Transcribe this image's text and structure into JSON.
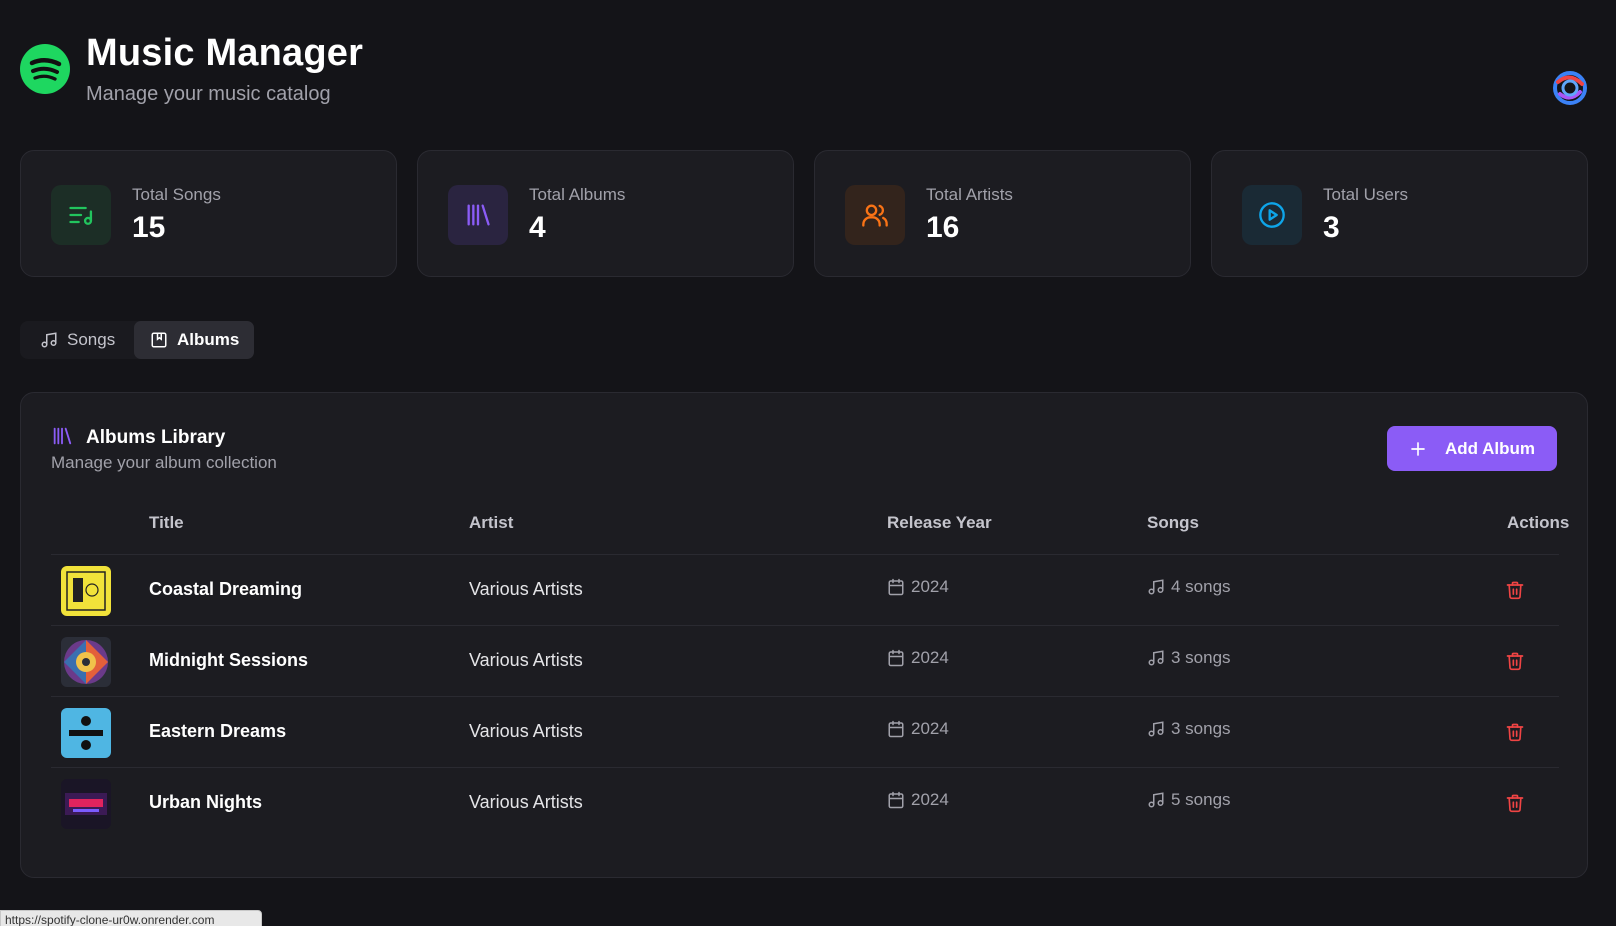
{
  "header": {
    "title": "Music Manager",
    "subtitle": "Manage your music catalog"
  },
  "stats": [
    {
      "label": "Total Songs",
      "value": "15",
      "icon": "music-list-icon",
      "color": "#22c55e"
    },
    {
      "label": "Total Albums",
      "value": "4",
      "icon": "library-icon",
      "color": "#8b5cf6"
    },
    {
      "label": "Total Artists",
      "value": "16",
      "icon": "users-icon",
      "color": "#f97316"
    },
    {
      "label": "Total Users",
      "value": "3",
      "icon": "play-circle-icon",
      "color": "#0ea5e9"
    }
  ],
  "tabs": [
    {
      "label": "Songs",
      "icon": "music-note-icon",
      "active": false
    },
    {
      "label": "Albums",
      "icon": "album-icon",
      "active": true
    }
  ],
  "panel": {
    "title": "Albums Library",
    "subtitle": "Manage your album collection",
    "add_label": "Add Album"
  },
  "table": {
    "columns": [
      "Title",
      "Artist",
      "Release Year",
      "Songs",
      "Actions"
    ],
    "rows": [
      {
        "title": "Coastal Dreaming",
        "artist": "Various Artists",
        "year": "2024",
        "songs": "4 songs",
        "cover": "cover-yellow"
      },
      {
        "title": "Midnight Sessions",
        "artist": "Various Artists",
        "year": "2024",
        "songs": "3 songs",
        "cover": "cover-rainbow"
      },
      {
        "title": "Eastern Dreams",
        "artist": "Various Artists",
        "year": "2024",
        "songs": "3 songs",
        "cover": "cover-blue-divide"
      },
      {
        "title": "Urban Nights",
        "artist": "Various Artists",
        "year": "2024",
        "songs": "5 songs",
        "cover": "cover-neon"
      }
    ]
  },
  "status_bar": {
    "url": "https://spotify-clone-ur0w.onrender.com"
  },
  "colors": {
    "background": "#141418",
    "card": "#1c1c21",
    "accent": "#8b5cf6",
    "danger": "#ef4444",
    "brand": "#1ed760"
  }
}
